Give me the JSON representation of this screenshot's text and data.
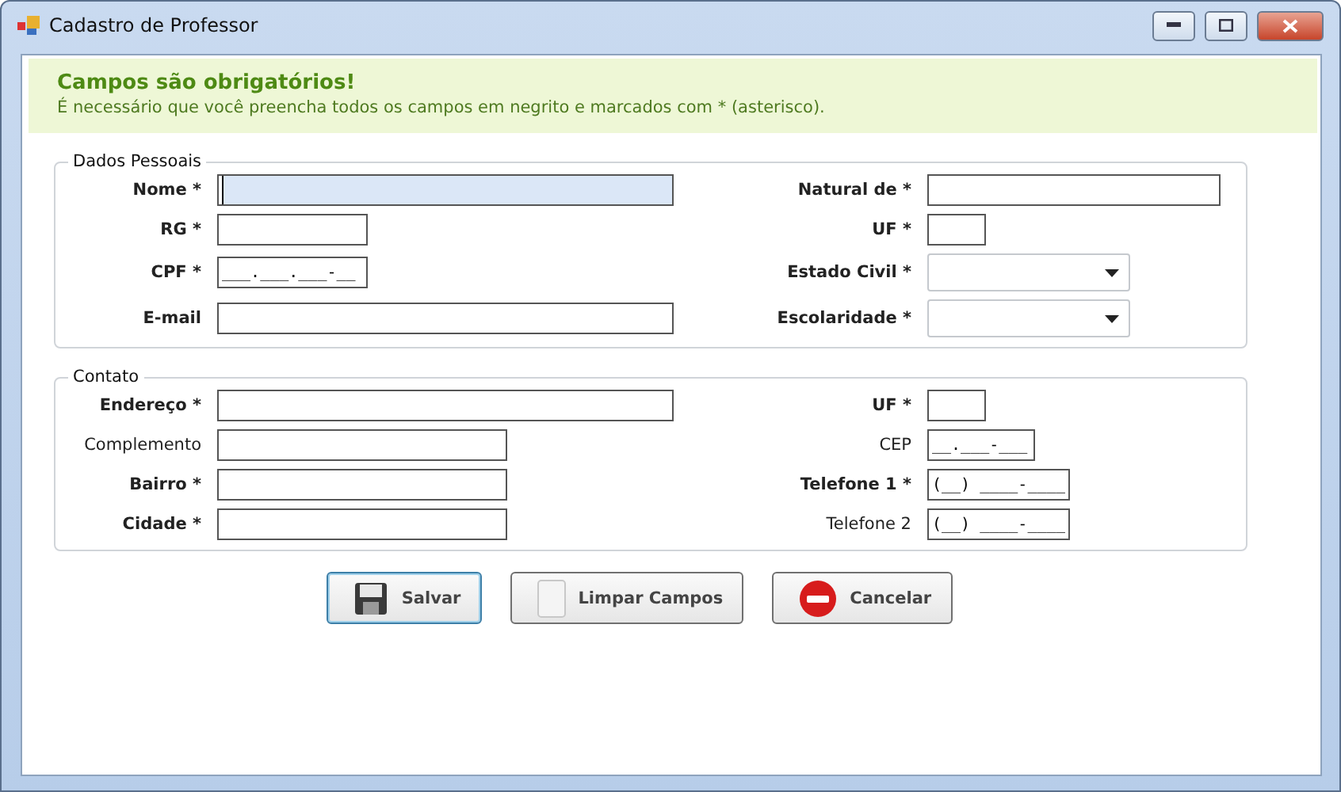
{
  "window": {
    "title": "Cadastro de Professor"
  },
  "notice": {
    "title": "Campos são obrigatórios!",
    "text": "É necessário que você preencha todos os campos em negrito e marcados com * (asterisco)."
  },
  "sections": [
    {
      "title": "Dados Pessoais",
      "rows": [
        {
          "left": {
            "label": "Nome *",
            "bold": true,
            "kind": "text",
            "focused": true
          },
          "right": {
            "label": "Natural de *",
            "bold": true,
            "kind": "text",
            "focused": false
          }
        },
        {
          "left": {
            "label": "RG *",
            "bold": true,
            "kind": "text",
            "focused": false
          },
          "right": {
            "label": "UF *",
            "bold": true,
            "kind": "text",
            "focused": false
          }
        },
        {
          "left": {
            "label": "CPF *",
            "bold": true,
            "kind": "text",
            "value": "___.___.___-__",
            "focused": false
          },
          "right": {
            "label": "Estado Civil *",
            "bold": true,
            "kind": "combo",
            "focused": false
          }
        },
        {
          "left": {
            "label": "E-mail",
            "bold": true,
            "kind": "text",
            "focused": false
          },
          "right": {
            "label": "Escolaridade *",
            "bold": true,
            "kind": "combo",
            "focused": false
          }
        }
      ]
    },
    {
      "title": "Contato",
      "rows": [
        {
          "left": {
            "label": "Endereço *",
            "bold": true,
            "kind": "text",
            "focused": false
          },
          "right": {
            "label": "UF *",
            "bold": true,
            "kind": "text",
            "focused": false
          }
        },
        {
          "left": {
            "label": "Complemento",
            "bold": false,
            "kind": "text",
            "focused": false
          },
          "right": {
            "label": "CEP",
            "bold": false,
            "kind": "text",
            "value": "__.___-___",
            "focused": false
          }
        },
        {
          "left": {
            "label": "Bairro *",
            "bold": true,
            "kind": "text",
            "focused": false
          },
          "right": {
            "label": "Telefone 1 *",
            "bold": true,
            "kind": "text",
            "value": "(__) ____-____",
            "focused": false
          }
        },
        {
          "left": {
            "label": "Cidade *",
            "bold": true,
            "kind": "text",
            "focused": false
          },
          "right": {
            "label": "Telefone 2",
            "bold": false,
            "kind": "text",
            "value": "(__) ____-____",
            "focused": false
          }
        }
      ]
    }
  ],
  "buttons": [
    {
      "label": "Salvar",
      "kind": "save",
      "focused": true
    },
    {
      "label": "Limpar Campos",
      "kind": "clear",
      "focused": false
    },
    {
      "label": "Cancelar",
      "kind": "cancel",
      "focused": false
    }
  ]
}
